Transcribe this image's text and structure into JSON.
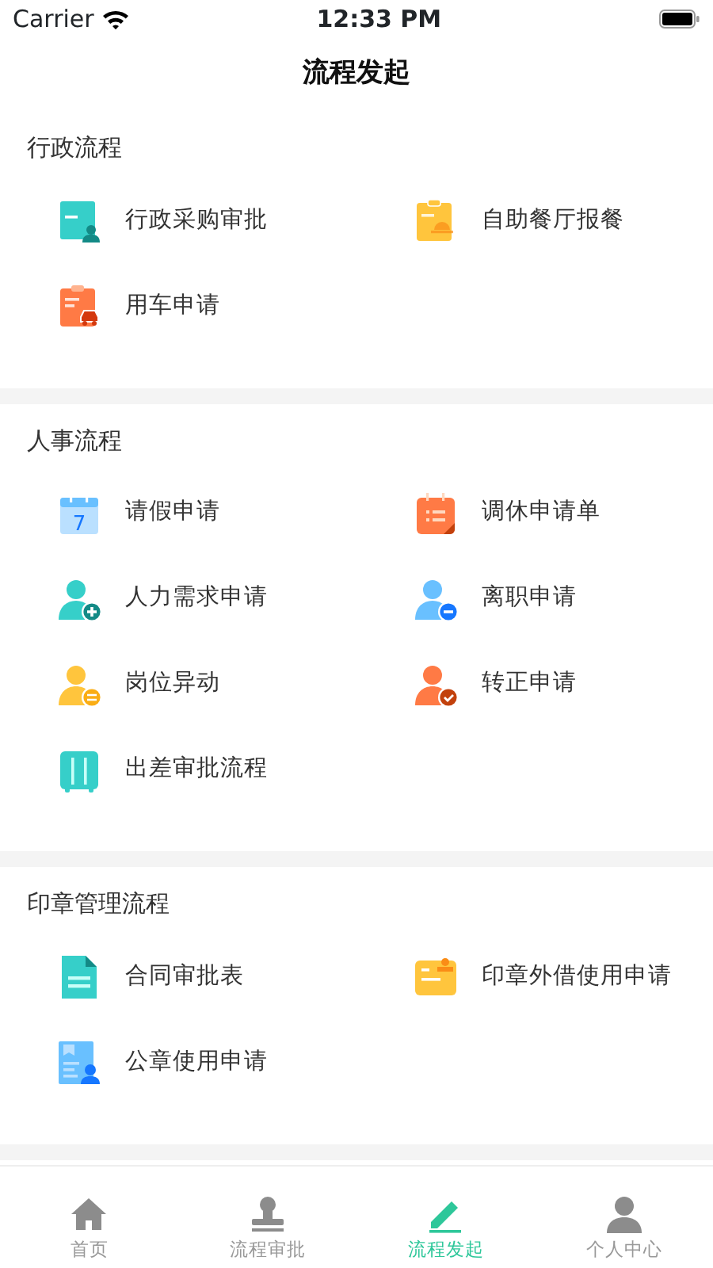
{
  "status_bar": {
    "carrier": "Carrier",
    "time": "12:33 PM"
  },
  "title": "流程发起",
  "sections": [
    {
      "title": "行政流程",
      "items": [
        {
          "label": "行政采购审批",
          "kind": "doc-person",
          "color": "#36cfc9"
        },
        {
          "label": "自助餐厅报餐",
          "kind": "clipboard-bell",
          "color": "#ffc53d"
        },
        {
          "label": "用车申请",
          "kind": "clipboard-car",
          "color": "#ff7a45"
        }
      ]
    },
    {
      "title": "人事流程",
      "items": [
        {
          "label": "请假申请",
          "kind": "calendar",
          "color": "#69c0ff",
          "icon_text": "7"
        },
        {
          "label": "调休申请单",
          "kind": "calendar-list",
          "color": "#ff7a45"
        },
        {
          "label": "人力需求申请",
          "kind": "person-plus",
          "color": "#36cfc9"
        },
        {
          "label": "离职申请",
          "kind": "person-minus",
          "color": "#69c0ff"
        },
        {
          "label": "岗位异动",
          "kind": "person-swap",
          "color": "#ffc53d"
        },
        {
          "label": "转正申请",
          "kind": "person-check",
          "color": "#ff7a45"
        },
        {
          "label": "出差审批流程",
          "kind": "suitcase",
          "color": "#36cfc9"
        }
      ]
    },
    {
      "title": "印章管理流程",
      "items": [
        {
          "label": "合同审批表",
          "kind": "document",
          "color": "#36cfc9"
        },
        {
          "label": "印章外借使用申请",
          "kind": "stamp-doc",
          "color": "#ffc53d"
        },
        {
          "label": "公章使用申请",
          "kind": "id-person",
          "color": "#69c0ff"
        }
      ]
    }
  ],
  "tabs": [
    {
      "label": "首页",
      "kind": "home",
      "selected": false
    },
    {
      "label": "流程审批",
      "kind": "stamp",
      "selected": false
    },
    {
      "label": "流程发起",
      "kind": "pencil",
      "selected": true
    },
    {
      "label": "个人中心",
      "kind": "person",
      "selected": false
    }
  ]
}
